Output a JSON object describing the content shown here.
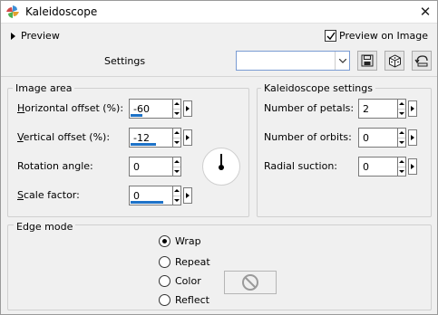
{
  "window": {
    "title": "Kaleidoscope",
    "close_glyph": "✕",
    "app_icon": "pinwheel-app-icon"
  },
  "preview": {
    "toggle_label": "Preview",
    "preview_on_image_label": "Preview on Image",
    "preview_on_image_checked": true
  },
  "settings": {
    "label": "Settings",
    "selected": "",
    "buttons": [
      "save-icon",
      "random-dice-icon",
      "reset-icon"
    ]
  },
  "image_area": {
    "title": "Image area",
    "horizontal_offset": {
      "label": "Horizontal offset (%):",
      "mnemonic": "H",
      "value": "-60"
    },
    "vertical_offset": {
      "label": "Vertical offset (%):",
      "mnemonic": "V",
      "value": "-12"
    },
    "rotation_angle": {
      "label": "Rotation angle:",
      "mnemonic": "a",
      "value": "0"
    },
    "scale_factor": {
      "label": "Scale factor:",
      "mnemonic": "S",
      "value": "0"
    }
  },
  "kaleidoscope": {
    "title": "Kaleidoscope settings",
    "petals": {
      "label": "Number of petals:",
      "mnemonic": "e",
      "value": "2"
    },
    "orbits": {
      "label": "Number of orbits:",
      "mnemonic": "i",
      "value": "0"
    },
    "radial_suction": {
      "label": "Radial suction:",
      "mnemonic": "R",
      "value": "0"
    }
  },
  "edge_mode": {
    "title": "Edge mode",
    "options": [
      {
        "label": "Wrap",
        "mnemonic": "W",
        "selected": true
      },
      {
        "label": "Repeat",
        "mnemonic": "t",
        "selected": false
      },
      {
        "label": "Color",
        "mnemonic": "C",
        "selected": false
      },
      {
        "label": "Reflect",
        "mnemonic": "f",
        "selected": false
      }
    ],
    "color_swatch_icon": "no-symbol-icon"
  },
  "colors": {
    "accent": "#1e73c8",
    "background": "#f0f0f0"
  }
}
